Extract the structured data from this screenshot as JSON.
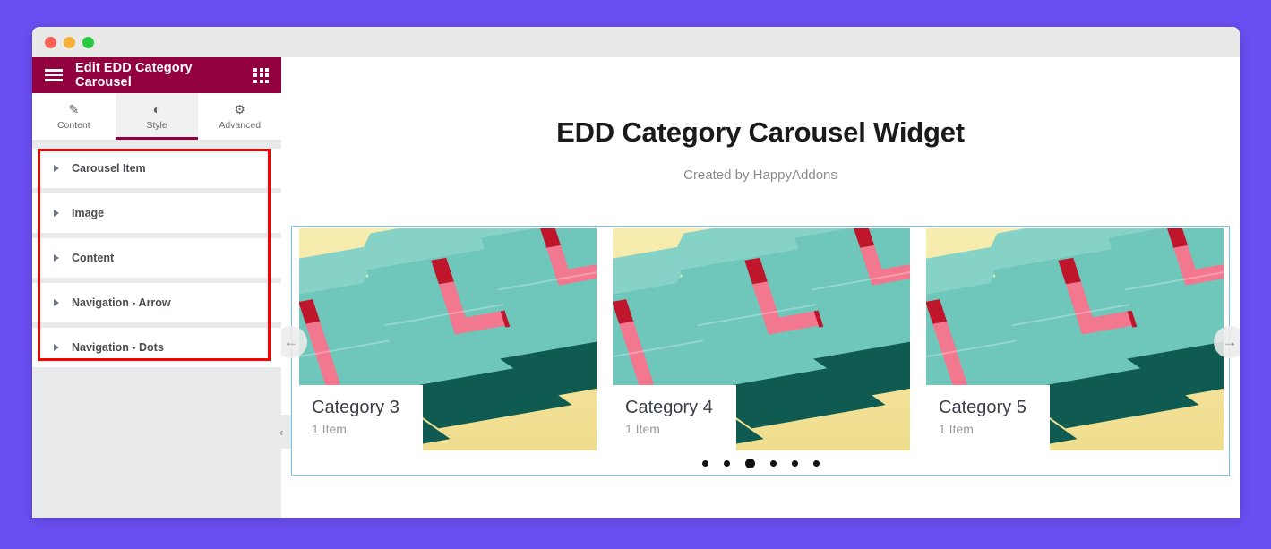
{
  "window": {
    "traffic_lights": [
      "close",
      "minimize",
      "maximize"
    ]
  },
  "panel": {
    "header": {
      "menu_icon": "hamburger-icon",
      "title": "Edit EDD Category Carousel",
      "apps_icon": "grid-icon"
    },
    "tabs": [
      {
        "label": "Content",
        "icon": "pencil-icon",
        "glyph": "✎",
        "active": false
      },
      {
        "label": "Style",
        "icon": "contrast-icon",
        "glyph": "◐",
        "active": true
      },
      {
        "label": "Advanced",
        "icon": "gear-icon",
        "glyph": "⚙",
        "active": false
      }
    ],
    "sections": [
      {
        "label": "Carousel Item"
      },
      {
        "label": "Image"
      },
      {
        "label": "Content"
      },
      {
        "label": "Navigation - Arrow"
      },
      {
        "label": "Navigation - Dots"
      }
    ],
    "collapse_icon": "chevron-left-icon",
    "highlight_color": "#fc0000"
  },
  "canvas": {
    "title": "EDD Category Carousel Widget",
    "subtitle": "Created by HappyAddons",
    "carousel": {
      "selection_border_color": "#6ec6e8",
      "prev_arrow": "←",
      "next_arrow": "→",
      "cards": [
        {
          "category": "Category 3",
          "count": "1 Item"
        },
        {
          "category": "Category 4",
          "count": "1 Item"
        },
        {
          "category": "Category 5",
          "count": "1 Item"
        }
      ],
      "dots": {
        "total": 6,
        "active_index": 2
      }
    }
  },
  "theme": {
    "background": "#6b4ef2",
    "header": "#93003f",
    "panel_bg": "#e9eaec"
  }
}
